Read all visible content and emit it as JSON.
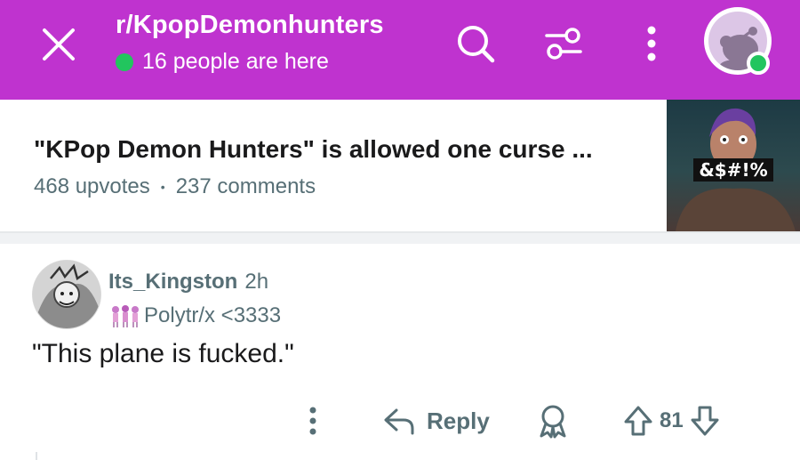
{
  "header": {
    "subreddit": "r/KpopDemonhunters",
    "online_text": "16 people are here",
    "background": "#bf33cf",
    "icons": [
      "close-icon",
      "search-icon",
      "filter-icon",
      "more-vertical-icon",
      "avatar"
    ]
  },
  "post": {
    "title": "\"KPop Demon Hunters\" is allowed one curse ...",
    "upvotes": "468 upvotes",
    "separator": "•",
    "comments": "237 comments",
    "thumbnail_text": "&$#!%"
  },
  "comment": {
    "username": "Its_Kingston",
    "time": "2h",
    "flair": "Polytr/x <3333",
    "body": "\"This plane is fucked.\""
  },
  "actions": {
    "reply_label": "Reply",
    "vote_count": "81",
    "icons": [
      "more-vertical-icon",
      "reply-icon",
      "award-icon",
      "upvote-icon",
      "downvote-icon"
    ]
  }
}
